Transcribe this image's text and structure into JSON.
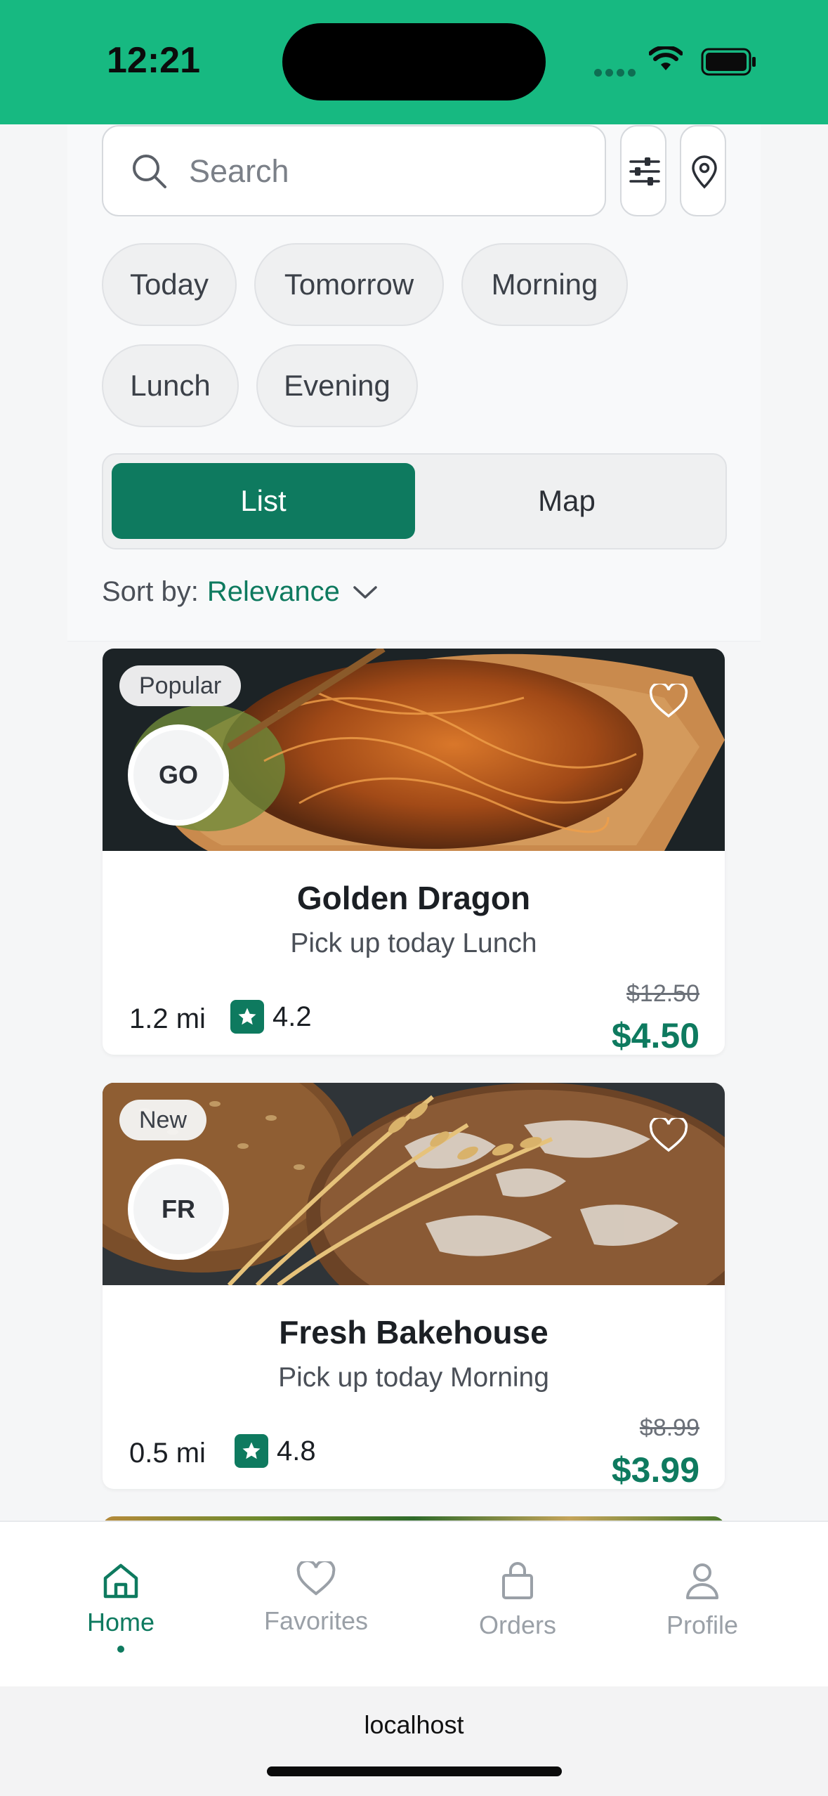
{
  "status_bar": {
    "time": "12:21"
  },
  "search": {
    "placeholder": "Search"
  },
  "chips": [
    "Today",
    "Tomorrow",
    "Morning",
    "Lunch",
    "Evening"
  ],
  "view_toggle": {
    "list": "List",
    "map": "Map",
    "selected": "List"
  },
  "sort": {
    "label": "Sort by:",
    "value": "Relevance"
  },
  "listings": [
    {
      "badge": "Popular",
      "avatar": "GO",
      "name": "Golden Dragon",
      "pickup": "Pick up today Lunch",
      "distance": "1.2 mi",
      "rating": "4.2",
      "original_price": "$12.50",
      "price": "$4.50"
    },
    {
      "badge": "New",
      "avatar": "FR",
      "name": "Fresh Bakehouse",
      "pickup": "Pick up today Morning",
      "distance": "0.5 mi",
      "rating": "4.8",
      "original_price": "$8.99",
      "price": "$3.99"
    }
  ],
  "tab_bar": {
    "tabs": [
      {
        "label": "Home",
        "icon": "home-icon",
        "active": true
      },
      {
        "label": "Favorites",
        "icon": "heart-icon",
        "active": false
      },
      {
        "label": "Orders",
        "icon": "bag-icon",
        "active": false
      },
      {
        "label": "Profile",
        "icon": "person-icon",
        "active": false
      }
    ]
  },
  "browser": {
    "url": "localhost"
  },
  "colors": {
    "brand": "#0e7a5f",
    "status_bar": "#17b981"
  }
}
